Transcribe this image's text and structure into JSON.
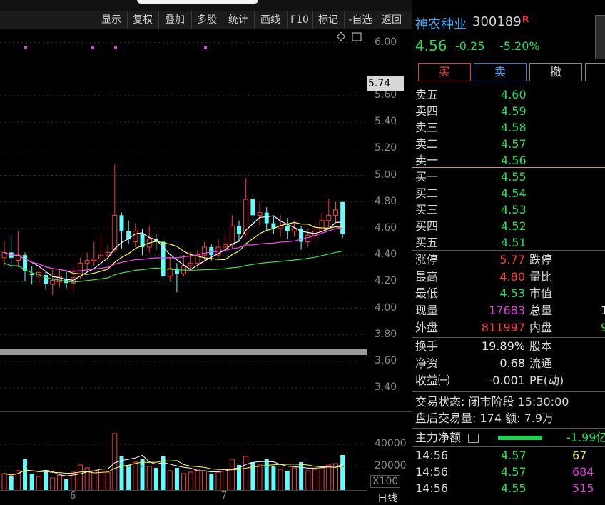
{
  "toolbar": {
    "items": [
      "显示",
      "复权",
      "叠加",
      "多股",
      "统计",
      "画线",
      "F10",
      "标记",
      "-自选",
      "返回"
    ]
  },
  "chart": {
    "y_labels": [
      "6.00",
      "5.60",
      "5.40",
      "5.20",
      "5.00",
      "4.80",
      "4.60",
      "4.40",
      "4.20",
      "4.00",
      "3.80",
      "3.60",
      "3.40"
    ],
    "current_price_tag": "5.74",
    "vol_labels": [
      "40000",
      "20000"
    ],
    "vol_unit": "X100",
    "x_labels": [
      "6",
      "7"
    ],
    "period": "日线",
    "colors": {
      "up": "#ff3b3b",
      "down": "#5fffff",
      "ma5": "#ffffff",
      "ma10": "#ffff40",
      "ma20": "#ff40ff",
      "ma60": "#40e040"
    }
  },
  "quote": {
    "name": "神农种业",
    "code": "300189",
    "badge": "R",
    "price": "4.56",
    "change": "-0.25",
    "change_pct": "-5.20%"
  },
  "buttons": {
    "buy": "买",
    "sell": "卖",
    "cancel": "撤"
  },
  "asks": [
    {
      "label": "卖五",
      "price": "4.60"
    },
    {
      "label": "卖四",
      "price": "4.59"
    },
    {
      "label": "卖三",
      "price": "4.58"
    },
    {
      "label": "卖二",
      "price": "4.57"
    },
    {
      "label": "卖一",
      "price": "4.56"
    }
  ],
  "bids": [
    {
      "label": "买一",
      "price": "4.55"
    },
    {
      "label": "买二",
      "price": "4.54"
    },
    {
      "label": "买三",
      "price": "4.53"
    },
    {
      "label": "买四",
      "price": "4.52"
    },
    {
      "label": "买五",
      "price": "4.51"
    }
  ],
  "stats": {
    "limit_up_label": "涨停",
    "limit_up": "5.77",
    "limit_down_label": "跌停",
    "high_label": "最高",
    "high": "4.80",
    "vol_ratio_label": "量比",
    "low_label": "最低",
    "low": "4.53",
    "mkt_cap_label": "市值",
    "cur_vol_label": "现量",
    "cur_vol": "17683",
    "total_vol_label": "总量",
    "total_vol_partial": "1",
    "outer_label": "外盘",
    "outer": "811997",
    "inner_label": "内盘",
    "inner_partial": "9",
    "turnover_label": "换手",
    "turnover": "19.89%",
    "share_cap_label": "股本",
    "nav_label": "净资",
    "nav": "0.68",
    "float_label": "流通",
    "eps_label": "收益㈠",
    "eps": "-0.001",
    "pe_label": "PE(动)"
  },
  "status": {
    "trade_state": "交易状态: 闭市阶段 15:30:00",
    "after_hours": "盘后交易量: 174  额: 7.9万"
  },
  "main_force": {
    "label": "主力净额",
    "value": "-1.99亿"
  },
  "ticks": [
    {
      "time": "14:56",
      "price": "4.57",
      "vol": "67",
      "color": "yellow"
    },
    {
      "time": "14:56",
      "price": "4.57",
      "vol": "684",
      "color": "magenta"
    },
    {
      "time": "14:56",
      "price": "4.55",
      "vol": "515",
      "color": "magenta"
    }
  ],
  "chart_data": {
    "type": "candlestick",
    "candles": [
      {
        "o": 4.38,
        "c": 4.42,
        "h": 4.5,
        "l": 4.32
      },
      {
        "o": 4.42,
        "c": 4.38,
        "h": 4.55,
        "l": 4.3
      },
      {
        "o": 4.36,
        "c": 4.4,
        "h": 4.58,
        "l": 4.31
      },
      {
        "o": 4.4,
        "c": 4.28,
        "h": 4.42,
        "l": 4.2
      },
      {
        "o": 4.26,
        "c": 4.25,
        "h": 4.32,
        "l": 4.18
      },
      {
        "o": 4.24,
        "c": 4.27,
        "h": 4.3,
        "l": 4.17
      },
      {
        "o": 4.25,
        "c": 4.18,
        "h": 4.28,
        "l": 4.14
      },
      {
        "o": 4.18,
        "c": 4.21,
        "h": 4.29,
        "l": 4.1
      },
      {
        "o": 4.2,
        "c": 4.24,
        "h": 4.3,
        "l": 4.16
      },
      {
        "o": 4.22,
        "c": 4.19,
        "h": 4.28,
        "l": 4.15
      },
      {
        "o": 4.19,
        "c": 4.23,
        "h": 4.31,
        "l": 4.12
      },
      {
        "o": 4.24,
        "c": 4.34,
        "h": 4.38,
        "l": 4.22
      },
      {
        "o": 4.34,
        "c": 4.36,
        "h": 4.42,
        "l": 4.28
      },
      {
        "o": 4.36,
        "c": 4.37,
        "h": 4.5,
        "l": 4.32
      },
      {
        "o": 4.37,
        "c": 4.4,
        "h": 4.55,
        "l": 4.35
      },
      {
        "o": 4.4,
        "c": 4.42,
        "h": 4.48,
        "l": 4.36
      },
      {
        "o": 4.44,
        "c": 4.7,
        "h": 5.08,
        "l": 4.42
      },
      {
        "o": 4.7,
        "c": 4.58,
        "h": 4.72,
        "l": 4.45
      },
      {
        "o": 4.58,
        "c": 4.52,
        "h": 4.66,
        "l": 4.48
      },
      {
        "o": 4.5,
        "c": 4.58,
        "h": 4.64,
        "l": 4.46
      },
      {
        "o": 4.56,
        "c": 4.46,
        "h": 4.6,
        "l": 4.4
      },
      {
        "o": 4.46,
        "c": 4.52,
        "h": 4.62,
        "l": 4.42
      },
      {
        "o": 4.52,
        "c": 4.5,
        "h": 4.56,
        "l": 4.44
      },
      {
        "o": 4.5,
        "c": 4.24,
        "h": 4.52,
        "l": 4.2
      },
      {
        "o": 4.24,
        "c": 4.3,
        "h": 4.38,
        "l": 4.2
      },
      {
        "o": 4.3,
        "c": 4.26,
        "h": 4.34,
        "l": 4.12
      },
      {
        "o": 4.26,
        "c": 4.32,
        "h": 4.4,
        "l": 4.24
      },
      {
        "o": 4.32,
        "c": 4.34,
        "h": 4.42,
        "l": 4.28
      },
      {
        "o": 4.34,
        "c": 4.4,
        "h": 4.44,
        "l": 4.3
      },
      {
        "o": 4.4,
        "c": 4.46,
        "h": 4.5,
        "l": 4.36
      },
      {
        "o": 4.46,
        "c": 4.4,
        "h": 4.48,
        "l": 4.36
      },
      {
        "o": 4.4,
        "c": 4.46,
        "h": 4.52,
        "l": 4.38
      },
      {
        "o": 4.46,
        "c": 4.48,
        "h": 4.56,
        "l": 4.42
      },
      {
        "o": 4.48,
        "c": 4.62,
        "h": 4.7,
        "l": 4.45
      },
      {
        "o": 4.62,
        "c": 4.56,
        "h": 4.66,
        "l": 4.5
      },
      {
        "o": 4.56,
        "c": 4.82,
        "h": 4.98,
        "l": 4.54
      },
      {
        "o": 4.82,
        "c": 4.7,
        "h": 4.84,
        "l": 4.62
      },
      {
        "o": 4.7,
        "c": 4.72,
        "h": 4.8,
        "l": 4.62
      },
      {
        "o": 4.72,
        "c": 4.64,
        "h": 4.76,
        "l": 4.58
      },
      {
        "o": 4.64,
        "c": 4.6,
        "h": 4.7,
        "l": 4.56
      },
      {
        "o": 4.6,
        "c": 4.62,
        "h": 4.7,
        "l": 4.54
      },
      {
        "o": 4.62,
        "c": 4.58,
        "h": 4.68,
        "l": 4.52
      },
      {
        "o": 4.58,
        "c": 4.6,
        "h": 4.66,
        "l": 4.54
      },
      {
        "o": 4.6,
        "c": 4.5,
        "h": 4.62,
        "l": 4.44
      },
      {
        "o": 4.5,
        "c": 4.55,
        "h": 4.6,
        "l": 4.46
      },
      {
        "o": 4.55,
        "c": 4.58,
        "h": 4.64,
        "l": 4.5
      },
      {
        "o": 4.58,
        "c": 4.66,
        "h": 4.72,
        "l": 4.56
      },
      {
        "o": 4.66,
        "c": 4.7,
        "h": 4.82,
        "l": 4.6
      },
      {
        "o": 4.7,
        "c": 4.74,
        "h": 4.8,
        "l": 4.64
      },
      {
        "o": 4.8,
        "c": 4.56,
        "h": 4.8,
        "l": 4.53
      }
    ],
    "volumes": [
      12,
      10,
      14,
      22,
      12,
      10,
      14,
      9,
      11,
      8,
      13,
      18,
      16,
      14,
      15,
      13,
      40,
      24,
      18,
      20,
      22,
      17,
      16,
      24,
      14,
      16,
      12,
      13,
      15,
      14,
      12,
      13,
      15,
      22,
      18,
      24,
      20,
      18,
      22,
      17,
      15,
      14,
      16,
      20,
      14,
      15,
      16,
      18,
      19,
      25
    ],
    "y_range": [
      3.25,
      6.1
    ]
  }
}
